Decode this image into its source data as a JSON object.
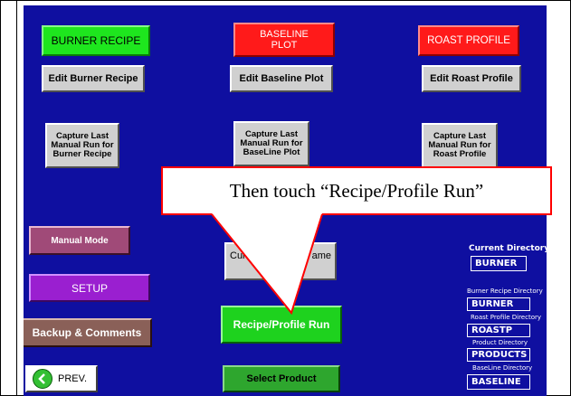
{
  "headers": {
    "burner_recipe": "BURNER RECIPE",
    "baseline_plot_line1": "BASELINE",
    "baseline_plot_line2": "PLOT",
    "roast_profile": "ROAST PROFILE"
  },
  "edit_buttons": {
    "burner": "Edit Burner Recipe",
    "baseline": "Edit Baseline Plot",
    "roast": "Edit Roast Profile"
  },
  "capture_buttons": {
    "burner": [
      "Capture Last",
      "Manual Run for",
      "Burner Recipe"
    ],
    "baseline": [
      "Capture Last",
      "Manual Run for",
      "BaseLine Plot"
    ],
    "roast": [
      "Capture Last",
      "Manual Run for",
      "Roast Profile"
    ]
  },
  "left_buttons": {
    "manual_mode": "Manual Mode",
    "setup": "SETUP",
    "backup": "Backup & Comments",
    "prev": "PREV."
  },
  "center_buttons": {
    "current_name_left": "Curre",
    "current_name_right": "ame",
    "current_name_line2": "T",
    "run": "Recipe/Profile Run",
    "select_product": "Select Product"
  },
  "directories": {
    "current_label": "Current Directory",
    "current_value": "BURNER",
    "burner_label": "Burner Recipe Directory",
    "burner_value": "BURNER",
    "roast_label": "Roast Profile Directory",
    "roast_value": "ROASTP",
    "product_label": "Product  Directory",
    "product_value": "PRODUCTS",
    "baseline_label": "BaseLine Directory",
    "baseline_value": "BASELINE"
  },
  "callout": {
    "text": "Then touch “Recipe/Profile Run”",
    "border_color": "#ff0000"
  },
  "colors": {
    "panel_bg": "#0f0fa0",
    "header_green": "#1ee61e",
    "header_red": "#ff1a1a",
    "run_green": "#1ed21e"
  }
}
